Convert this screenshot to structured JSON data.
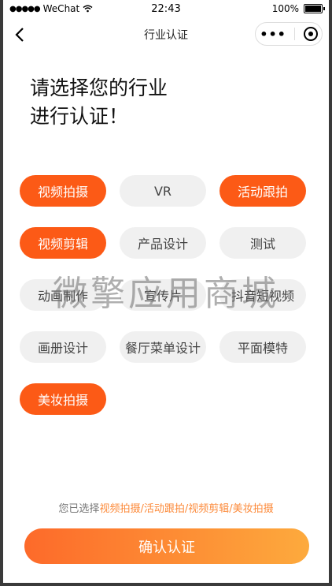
{
  "status_bar": {
    "carrier": "WeChat",
    "time": "22:43",
    "battery": "100%"
  },
  "nav": {
    "title": "行业认证"
  },
  "heading": {
    "line1": "请选择您的行业",
    "line2": "进行认证！"
  },
  "tags": [
    {
      "label": "视频拍摄",
      "selected": true
    },
    {
      "label": "VR",
      "selected": false
    },
    {
      "label": "活动跟拍",
      "selected": true
    },
    {
      "label": "视频剪辑",
      "selected": true
    },
    {
      "label": "产品设计",
      "selected": false
    },
    {
      "label": "测试",
      "selected": false
    },
    {
      "label": "动画制作",
      "selected": false
    },
    {
      "label": "宣传片",
      "selected": false
    },
    {
      "label": "抖音短视频",
      "selected": false
    },
    {
      "label": "画册设计",
      "selected": false
    },
    {
      "label": "餐厅菜单设计",
      "selected": false
    },
    {
      "label": "平面模特",
      "selected": false
    },
    {
      "label": "美妆拍摄",
      "selected": true
    }
  ],
  "watermark": "微擎应用商城",
  "summary": {
    "prefix": "您已选择",
    "selected_text": "视频拍摄/活动跟拍/视频剪辑/美妆拍摄"
  },
  "confirm_label": "确认认证",
  "colors": {
    "accent": "#fc5a16",
    "gradient_start": "#fd6a2a",
    "gradient_end": "#fdaa3d",
    "tag_bg": "#f0f0f0"
  }
}
